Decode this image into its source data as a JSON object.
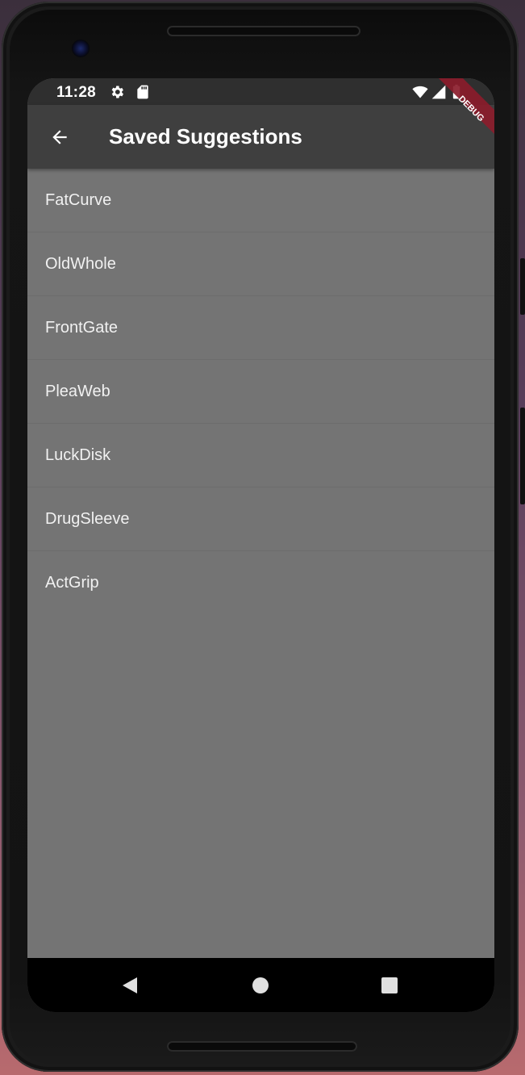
{
  "status_bar": {
    "time": "11:28",
    "icons": [
      "gear-icon",
      "sd-card-icon",
      "wifi-icon",
      "signal-icon",
      "battery-icon"
    ]
  },
  "debug_banner": {
    "label": "DEBUG",
    "color": "#8b1c2b"
  },
  "app_bar": {
    "title": "Saved Suggestions",
    "back_icon": "arrow-back-icon",
    "background": "#3f3f3f"
  },
  "suggestions": [
    "FatCurve",
    "OldWhole",
    "FrontGate",
    "PleaWeb",
    "LuckDisk",
    "DrugSleeve",
    "ActGrip"
  ],
  "nav_bar": {
    "buttons": [
      "back-triangle-icon",
      "home-circle-icon",
      "recents-square-icon"
    ]
  },
  "colors": {
    "list_background": "#747474",
    "text": "#f1f1f1"
  }
}
